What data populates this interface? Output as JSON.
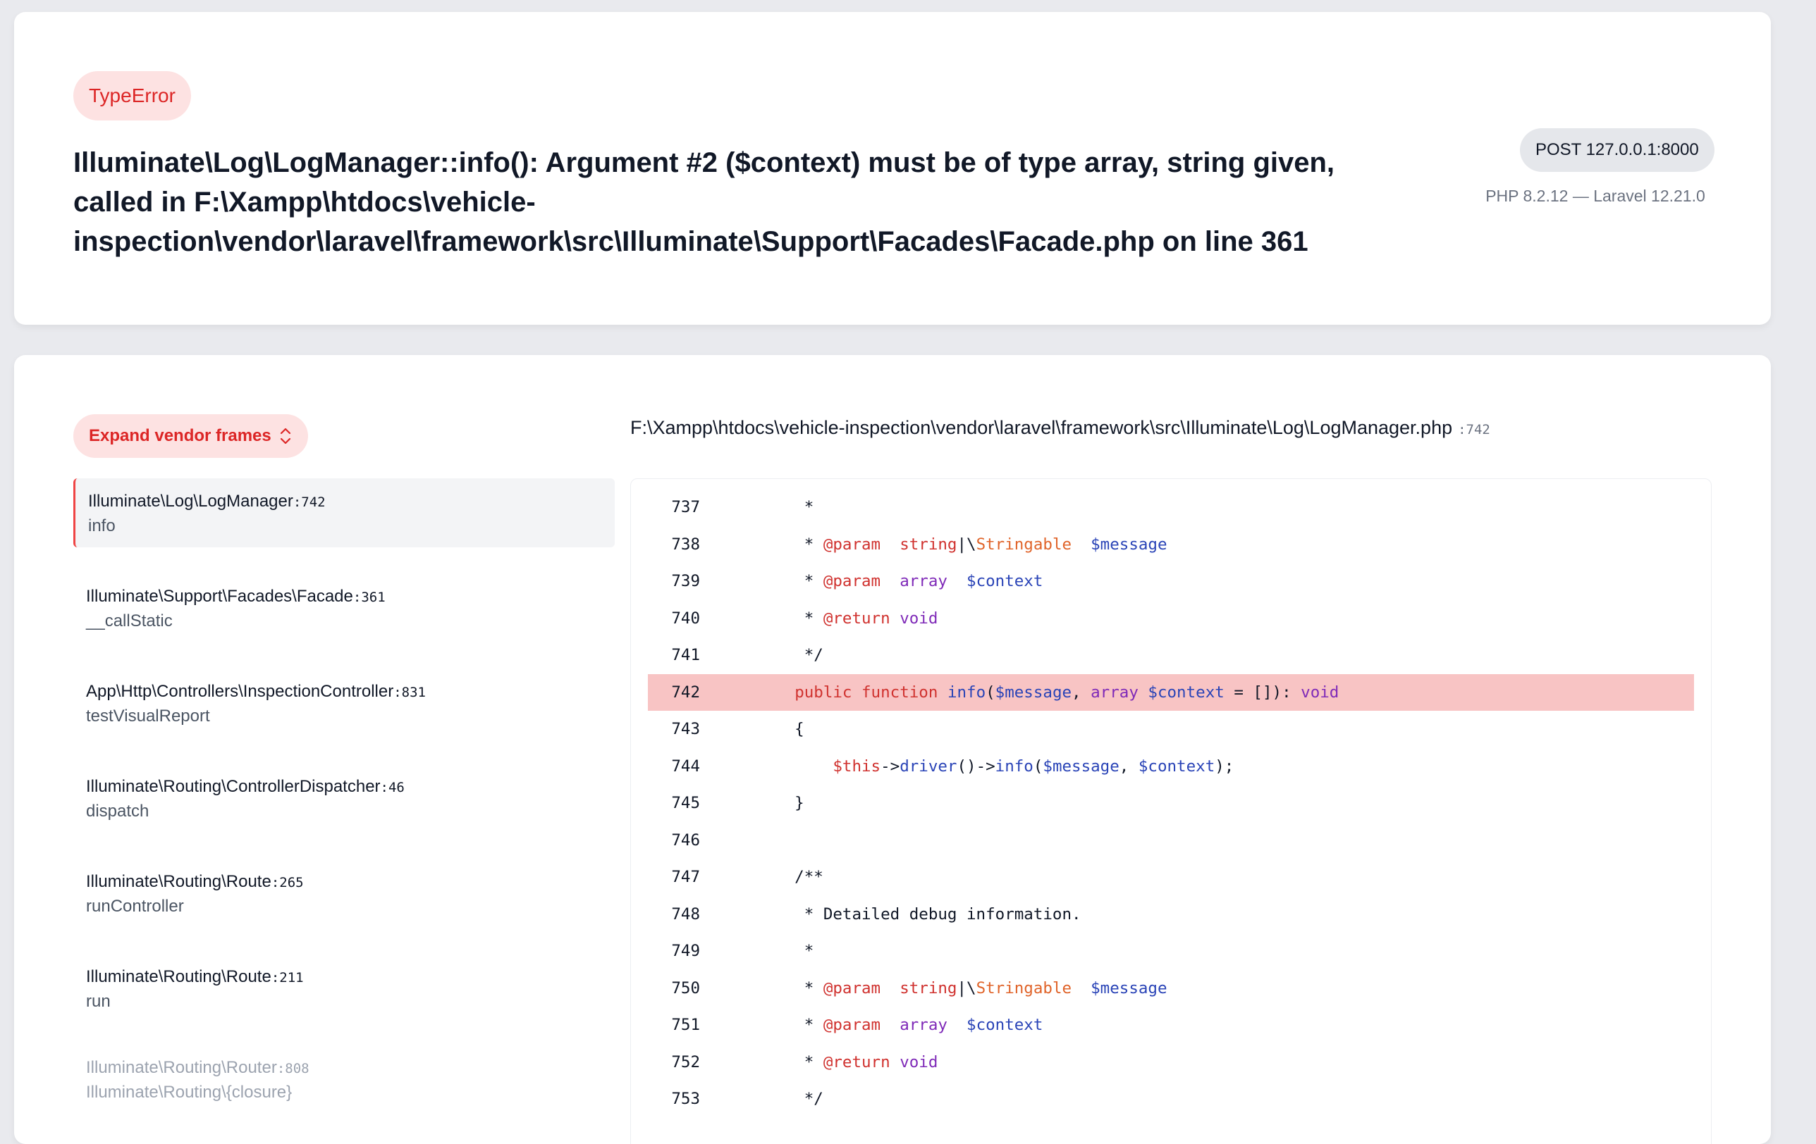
{
  "error": {
    "type": "TypeError",
    "message": "Illuminate\\Log\\LogManager::info(): Argument #2 ($context) must be of type array, string given, called in F:\\Xampp\\htdocs\\vehicle-inspection\\vendor\\laravel\\framework\\src\\Illuminate\\Support\\Facades\\Facade.php on line 361"
  },
  "request": {
    "method_url": "POST 127.0.0.1:8000",
    "versions": "PHP 8.2.12 — Laravel 12.21.0"
  },
  "trace": {
    "expand_label": "Expand vendor frames",
    "frames": [
      {
        "class": "Illuminate\\Log\\LogManager",
        "line": ":742",
        "fn": "info"
      },
      {
        "class": "Illuminate\\Support\\Facades\\Facade",
        "line": ":361",
        "fn": "__callStatic"
      },
      {
        "class": "App\\Http\\Controllers\\InspectionController",
        "line": ":831",
        "fn": "testVisualReport"
      },
      {
        "class": "Illuminate\\Routing\\ControllerDispatcher",
        "line": ":46",
        "fn": "dispatch"
      },
      {
        "class": "Illuminate\\Routing\\Route",
        "line": ":265",
        "fn": "runController"
      },
      {
        "class": "Illuminate\\Routing\\Route",
        "line": ":211",
        "fn": "run"
      },
      {
        "class": "Illuminate\\Routing\\Router",
        "line": ":808",
        "fn": "Illuminate\\Routing\\{closure}"
      }
    ]
  },
  "code": {
    "file": "F:\\Xampp\\htdocs\\vehicle-inspection\\vendor\\laravel\\framework\\src\\Illuminate\\Log\\LogManager.php",
    "file_line": ":742",
    "lines": [
      {
        "n": "737",
        "t": "     *"
      },
      {
        "n": "738",
        "t": "     * @param  string|\\Stringable  $message"
      },
      {
        "n": "739",
        "t": "     * @param  array  $context"
      },
      {
        "n": "740",
        "t": "     * @return void"
      },
      {
        "n": "741",
        "t": "     */"
      },
      {
        "n": "742",
        "t": "    public function info($message, array $context = []): void"
      },
      {
        "n": "743",
        "t": "    {"
      },
      {
        "n": "744",
        "t": "        $this->driver()->info($message, $context);"
      },
      {
        "n": "745",
        "t": "    }"
      },
      {
        "n": "746",
        "t": ""
      },
      {
        "n": "747",
        "t": "    /**"
      },
      {
        "n": "748",
        "t": "     * Detailed debug information."
      },
      {
        "n": "749",
        "t": "     *"
      },
      {
        "n": "750",
        "t": "     * @param  string|\\Stringable  $message"
      },
      {
        "n": "751",
        "t": "     * @param  array  $context"
      },
      {
        "n": "752",
        "t": "     * @return void"
      },
      {
        "n": "753",
        "t": "     */"
      }
    ],
    "highlight_line": "742"
  }
}
